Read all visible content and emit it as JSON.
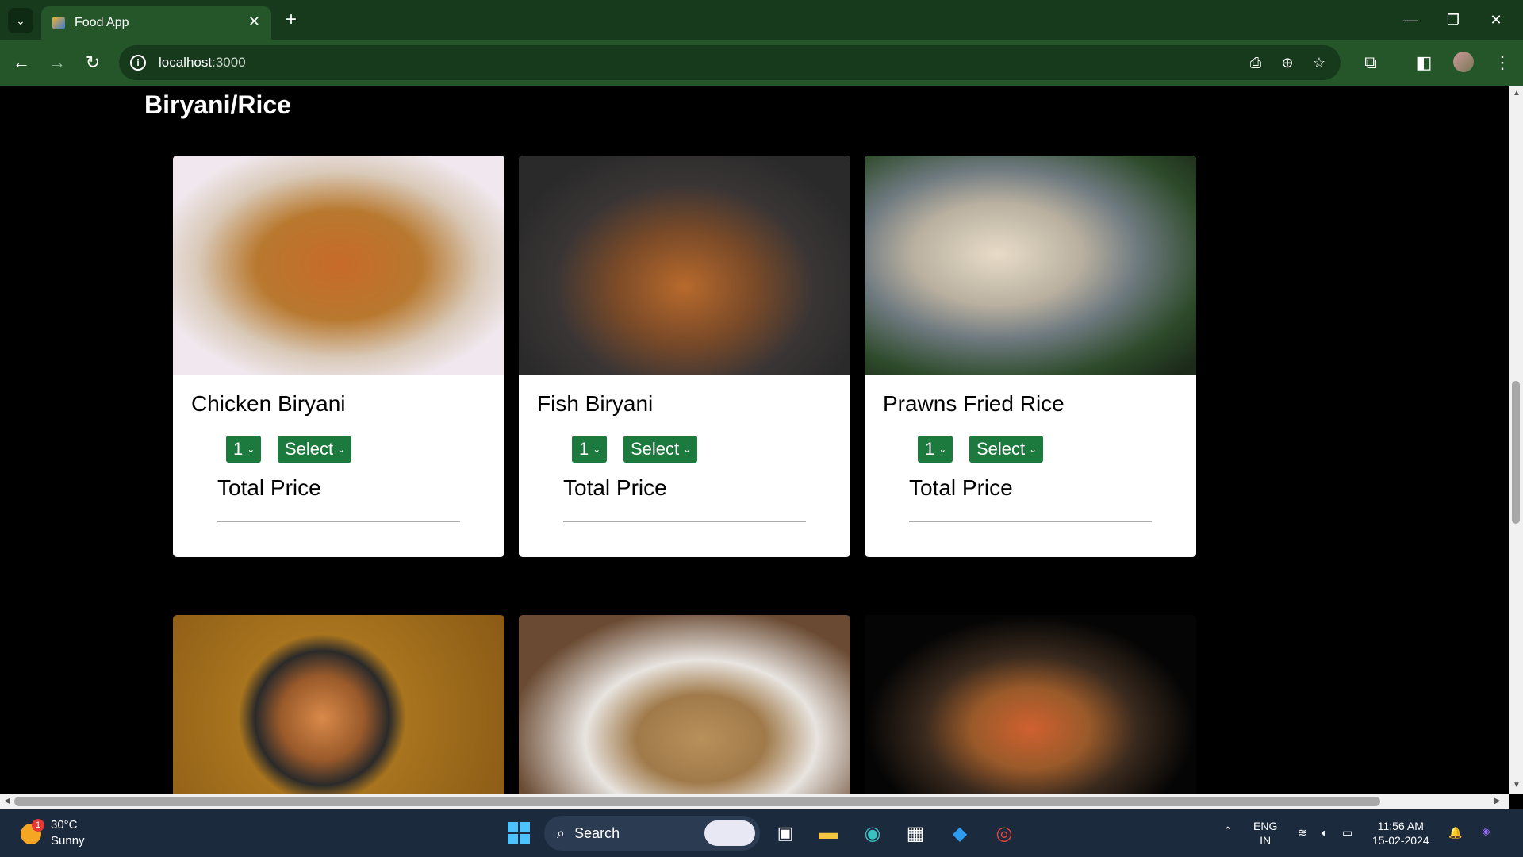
{
  "browser": {
    "tab_title": "Food App",
    "url_host": "localhost",
    "url_port": ":3000"
  },
  "section_title": "Biryani/Rice",
  "cards": [
    {
      "name": "Chicken Biryani",
      "qty": "1",
      "select": "Select",
      "total_label": "Total Price"
    },
    {
      "name": "Fish Biryani",
      "qty": "1",
      "select": "Select",
      "total_label": "Total Price"
    },
    {
      "name": "Prawns Fried Rice",
      "qty": "1",
      "select": "Select",
      "total_label": "Total Price"
    }
  ],
  "taskbar": {
    "temp": "30°C",
    "condition": "Sunny",
    "notif_count": "1",
    "search_label": "Search",
    "lang": "ENG",
    "region": "IN",
    "time": "11:56 AM",
    "date": "15-02-2024"
  },
  "colors": {
    "accent": "#1d7a3f",
    "browser_frame": "#24562a"
  }
}
